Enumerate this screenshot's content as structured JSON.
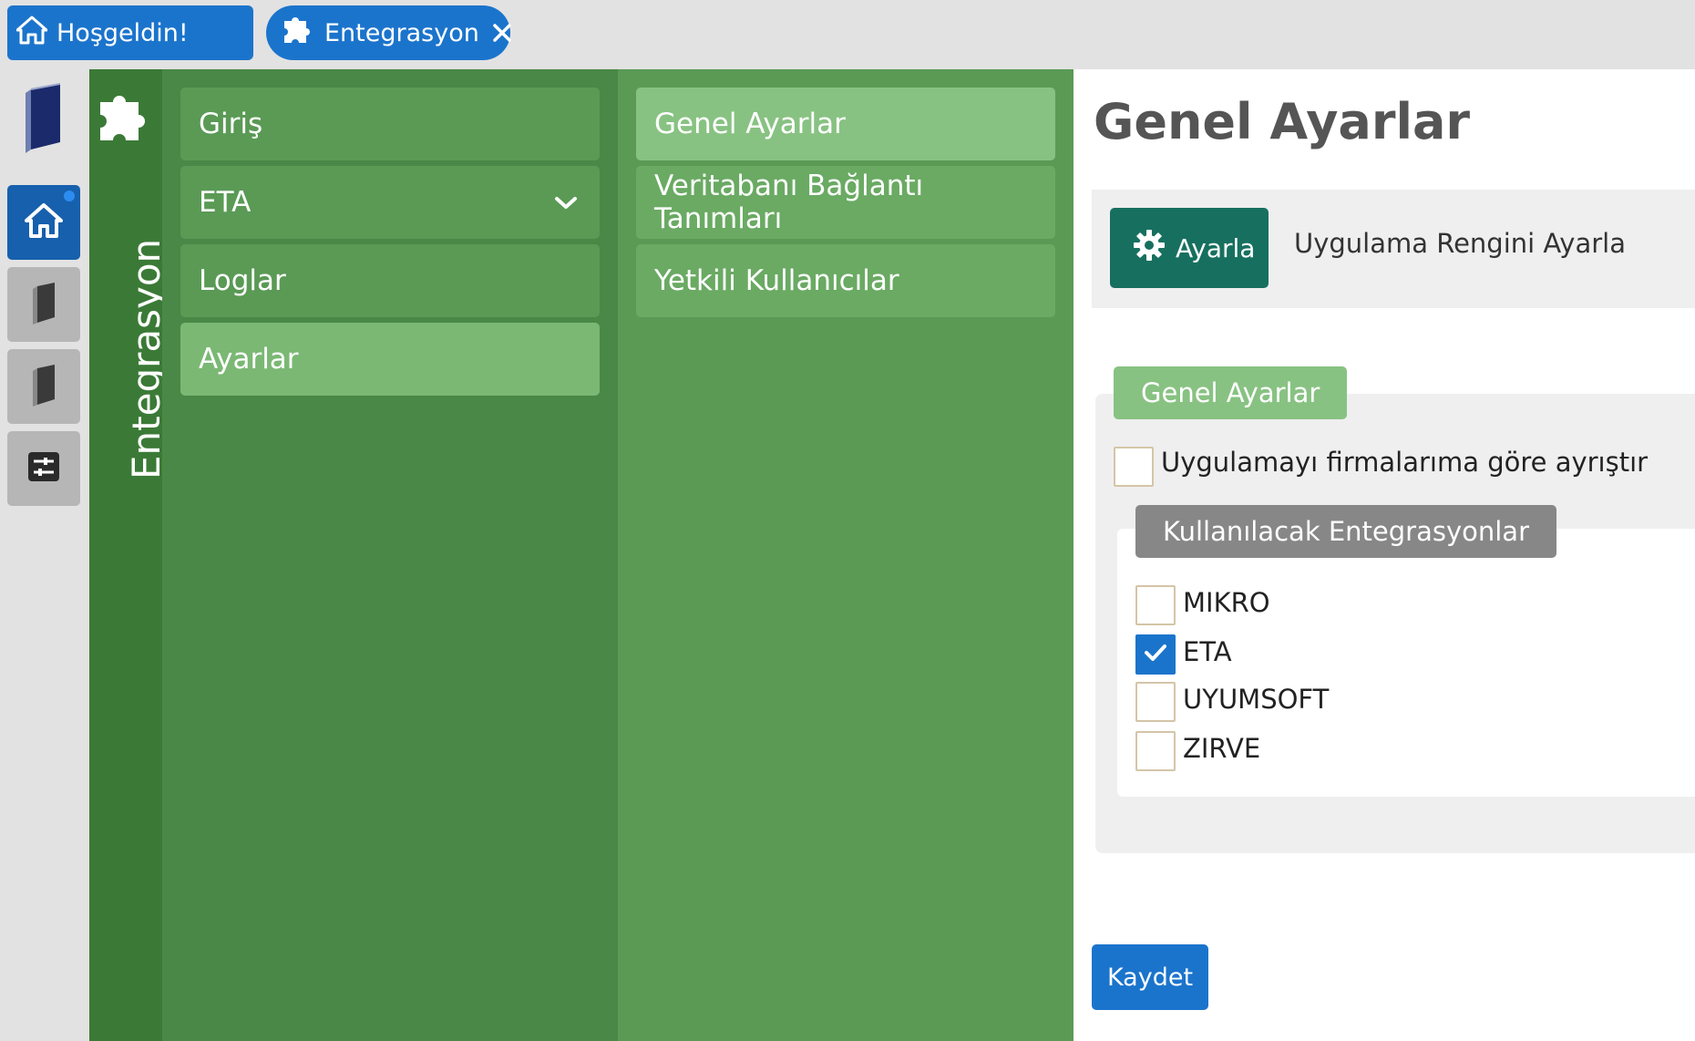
{
  "tabs": {
    "home": {
      "label": "Hoşgeldin!",
      "icon": "home-icon"
    },
    "integration": {
      "label": "Entegrasyon",
      "icon": "puzzle-icon",
      "close_icon": "close-icon"
    }
  },
  "rail": {
    "items": [
      {
        "name": "logo",
        "icon": "book-logo-icon"
      },
      {
        "name": "home",
        "icon": "home-icon",
        "active": true
      },
      {
        "name": "book-1",
        "icon": "book-icon"
      },
      {
        "name": "book-2",
        "icon": "book-icon"
      },
      {
        "name": "settings",
        "icon": "sliders-icon"
      }
    ]
  },
  "module": {
    "title": "Entegrasyon",
    "icon": "puzzle-icon"
  },
  "menu1": {
    "items": [
      {
        "label": "Giriş"
      },
      {
        "label": "ETA",
        "expandable": true
      },
      {
        "label": "Loglar"
      },
      {
        "label": "Ayarlar",
        "active": true
      }
    ]
  },
  "menu2": {
    "items": [
      {
        "label": "Genel Ayarlar",
        "active": true
      },
      {
        "label": "Veritabanı Bağlantı Tanımları"
      },
      {
        "label": "Yetkili Kullanıcılar"
      }
    ]
  },
  "content": {
    "title": "Genel Ayarlar",
    "color_setting": {
      "button_label": "Ayarla",
      "button_icon": "gear-icon",
      "label": "Uygulama Rengini Ayarla"
    },
    "general_section": {
      "legend": "Genel Ayarlar",
      "separate_by_company": {
        "label": "Uygulamayı firmalarıma göre ayrıştır",
        "checked": false
      }
    },
    "integrations_section": {
      "legend": "Kullanılacak Entegrasyonlar",
      "options": [
        {
          "label": "MIKRO",
          "checked": false
        },
        {
          "label": "ETA",
          "checked": true
        },
        {
          "label": "UYUMSOFT",
          "checked": false
        },
        {
          "label": "ZIRVE",
          "checked": false
        }
      ]
    },
    "save_label": "Kaydet"
  },
  "colors": {
    "primary_blue": "#1b74cc",
    "sidebar_green_dark": "#3b7a36",
    "menu_green": "#498846",
    "menu_green_light": "#5a9a55",
    "active_green": "#7bb874",
    "teal_button": "#17705f"
  }
}
